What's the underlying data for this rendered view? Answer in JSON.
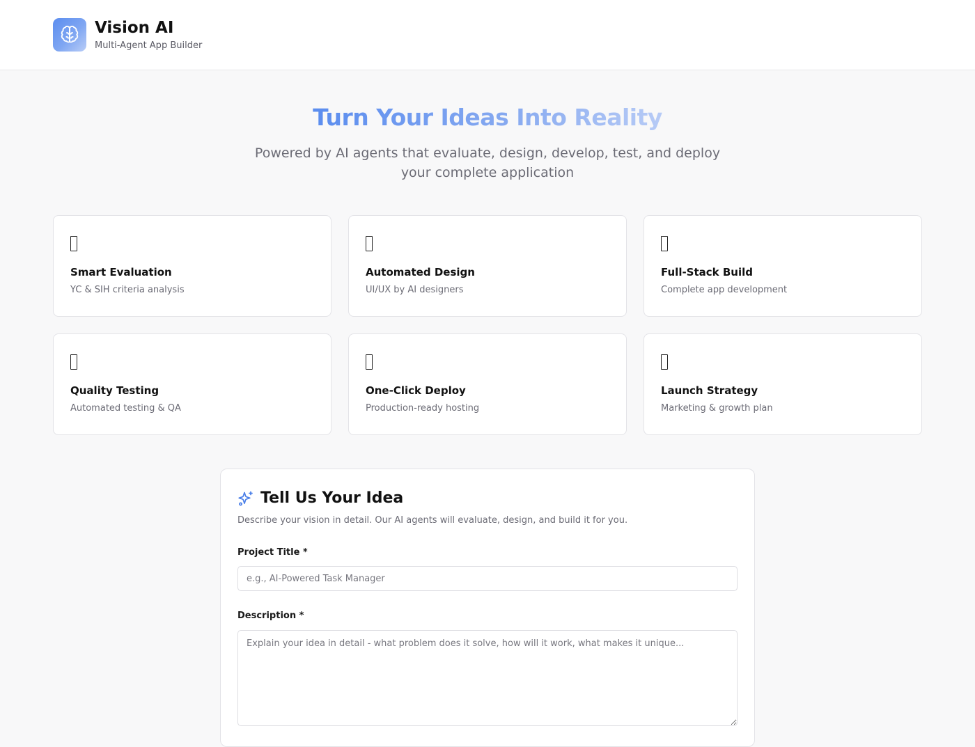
{
  "header": {
    "brand_title": "Vision AI",
    "brand_subtitle": "Multi-Agent App Builder",
    "logo_icon": "brain-icon"
  },
  "hero": {
    "title": "Turn Your Ideas Into Reality",
    "subtitle": "Powered by AI agents that evaluate, design, develop, test, and deploy your complete application"
  },
  "features": [
    {
      "title": "Smart Evaluation",
      "desc": "YC & SIH criteria analysis"
    },
    {
      "title": "Automated Design",
      "desc": "UI/UX by AI designers"
    },
    {
      "title": "Full-Stack Build",
      "desc": "Complete app development"
    },
    {
      "title": "Quality Testing",
      "desc": "Automated testing & QA"
    },
    {
      "title": "One-Click Deploy",
      "desc": "Production-ready hosting"
    },
    {
      "title": "Launch Strategy",
      "desc": "Marketing & growth plan"
    }
  ],
  "idea_form": {
    "title": "Tell Us Your Idea",
    "description": "Describe your vision in detail. Our AI agents will evaluate, design, and build it for you.",
    "title_label": "Project Title *",
    "title_placeholder": "e.g., AI-Powered Task Manager",
    "title_value": "",
    "desc_label": "Description *",
    "desc_placeholder": "Explain your idea in detail - what problem does it solve, how will it work, what makes it unique...",
    "desc_value": ""
  },
  "colors": {
    "accent": "#5b8def",
    "accent_light": "#b7cbf6",
    "background": "#f8f8f9"
  }
}
